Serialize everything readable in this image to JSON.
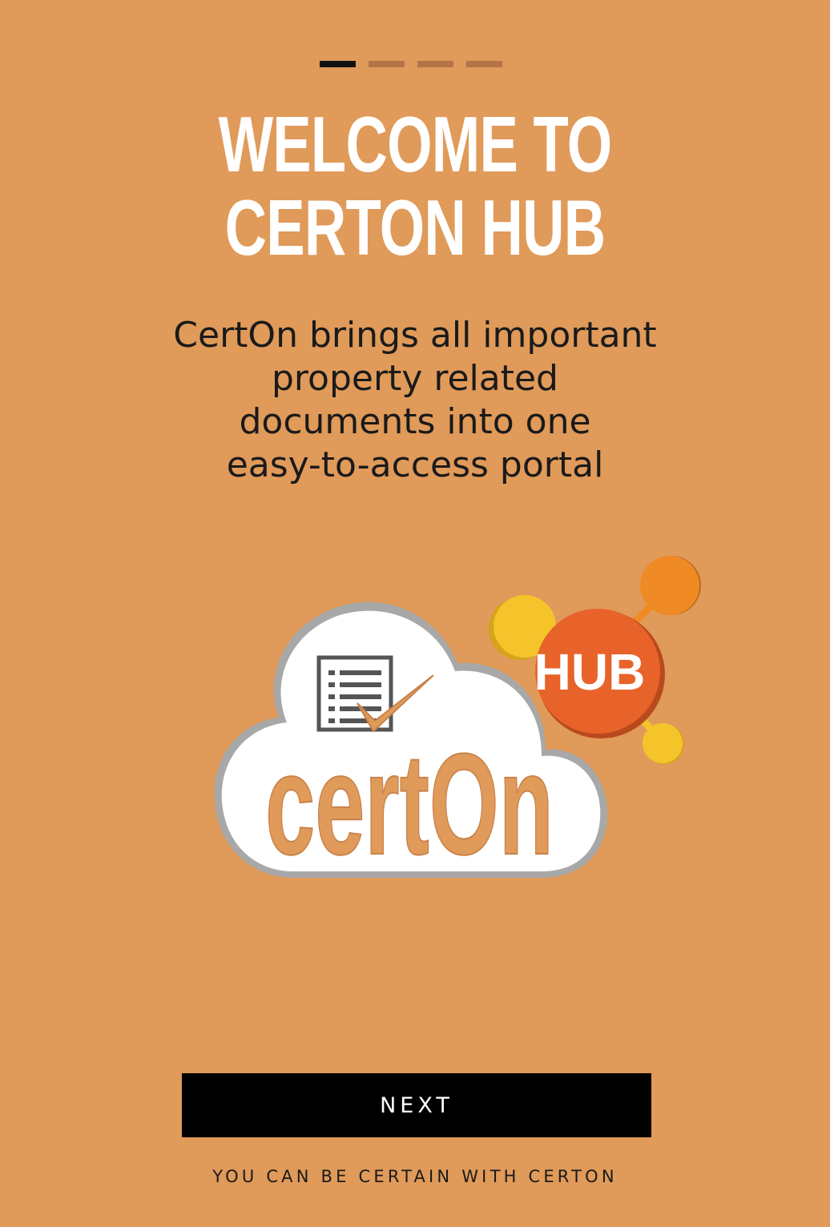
{
  "pager": {
    "total": 4,
    "current": 1
  },
  "title": {
    "line1": "WELCOME TO",
    "line2": "CERTON HUB"
  },
  "subtitle": {
    "line1": "CertOn brings all important",
    "line2": "property related",
    "line3": "documents into one",
    "line4": "easy-to-access portal"
  },
  "logo": {
    "wordmark": "certOn",
    "badge": "HUB"
  },
  "next_button": {
    "label": "NEXT"
  },
  "tagline": "YOU CAN BE CERTAIN WITH CERTON",
  "colors": {
    "background": "#E09A59",
    "pager_active": "#111111",
    "pager_inactive": "#B27545",
    "badge": "#E8632A",
    "node_orange": "#F08A24",
    "node_yellow": "#F5C42A"
  }
}
